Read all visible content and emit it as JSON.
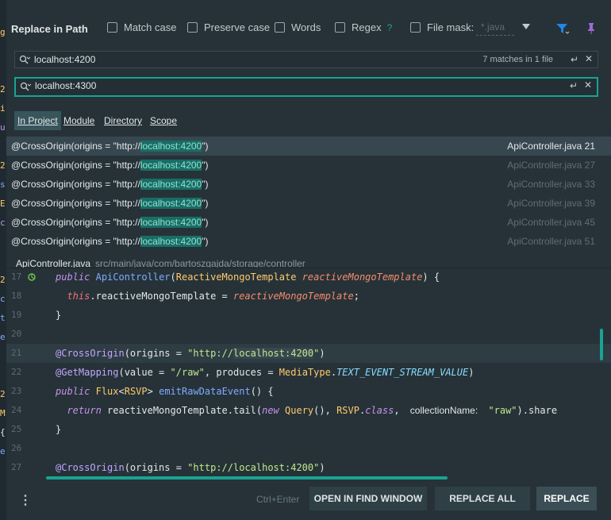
{
  "left_strip_chars": [
    "g",
    "2",
    "i",
    "u",
    "2",
    "s",
    "E",
    "c",
    "2",
    "c",
    "t",
    "e",
    "2",
    "M",
    "{",
    "e"
  ],
  "header": {
    "title": "Replace in Path",
    "options": [
      {
        "label": "Match case",
        "checked": false
      },
      {
        "label": "Preserve case",
        "checked": false
      },
      {
        "label": "Words",
        "checked": false
      },
      {
        "label": "Regex",
        "checked": false
      }
    ],
    "regex_help": "?",
    "file_mask_label": "File mask:",
    "file_mask_value": "*.java",
    "icons": [
      "filter-icon",
      "pin-icon"
    ]
  },
  "search": {
    "value": "localhost:4200",
    "matches": "7 matches in 1 file"
  },
  "replace": {
    "value": "localhost:4300"
  },
  "scopes": [
    "In Project",
    "Module",
    "Directory",
    "Scope"
  ],
  "results": [
    {
      "prefix": "@CrossOrigin(origins = \"http://",
      "match": "localhost:4200",
      "suffix": "\")",
      "file": "ApiController.java 21"
    },
    {
      "prefix": "@CrossOrigin(origins = \"http://",
      "match": "localhost:4200",
      "suffix": "\")",
      "file": "ApiController.java 27"
    },
    {
      "prefix": "@CrossOrigin(origins = \"http://",
      "match": "localhost:4200",
      "suffix": "\")",
      "file": "ApiController.java 33"
    },
    {
      "prefix": "@CrossOrigin(origins = \"http://",
      "match": "localhost:4200",
      "suffix": "\")",
      "file": "ApiController.java 39"
    },
    {
      "prefix": "@CrossOrigin(origins = \"http://",
      "match": "localhost:4200",
      "suffix": "\")",
      "file": "ApiController.java 45"
    },
    {
      "prefix": "@CrossOrigin(origins = \"http://",
      "match": "localhost:4200",
      "suffix": "\")",
      "file": "ApiController.java 51"
    }
  ],
  "preview": {
    "file_name": "ApiController.java",
    "file_path": "src/main/java/com/bartoszgajda/storage/controller",
    "line_numbers": [
      "17",
      "18",
      "19",
      "20",
      "21",
      "22",
      "23",
      "24",
      "25",
      "26",
      "27"
    ],
    "line17": {
      "kw": "public",
      "ty": "ApiController",
      "p1": "(",
      "ty2": "ReactiveMongoTemplate",
      "sp": " ",
      "it": "reactiveMongoTemplate",
      "p2": ") {"
    },
    "line18": {
      "kw": "this",
      "p1": ".reactiveMongoTemplate = ",
      "it": "reactiveMongoTemplate",
      "p2": ";"
    },
    "line19": "}",
    "line21": {
      "an": "@CrossOrigin",
      "p1": "(origins = ",
      "st": "\"http://",
      "hl": "localhost:4200",
      "st2": "\"",
      "p2": ")"
    },
    "line22": {
      "an": "@GetMapping",
      "p1": "(value = ",
      "st": "\"/raw\"",
      "p2": ", produces = ",
      "ty": "MediaType",
      "p3": ".",
      "cc": "TEXT_EVENT_STREAM_VALUE",
      "p4": ")"
    },
    "line23": {
      "kw": "public",
      "ty": "Flux",
      "p1": "<",
      "ty2": "RSVP",
      "p2": "> ",
      "fn": "emitRawDataEvent",
      "p3": "() {"
    },
    "line24": {
      "kw": "return",
      "p1": " reactiveMongoTemplate.tail(",
      "kw2": "new",
      "ty": "Query",
      "p2": "(), ",
      "ty2": "RSVP",
      "p3": ".",
      "kw3": "class",
      "p4": ",",
      "hint": "collectionName:",
      "st": "\"raw\"",
      "p5": ").share"
    },
    "line25": "}",
    "line27": {
      "an": "@CrossOrigin",
      "p1": "(origins = ",
      "st": "\"http://localhost:4200\"",
      "p2": ")"
    }
  },
  "footer": {
    "shortcut": "Ctrl+Enter",
    "open_in_find_window": "OPEN IN FIND WINDOW",
    "replace_all": "REPLACE ALL",
    "replace": "REPLACE"
  },
  "colors": {
    "accent": "#1aa391",
    "background": "#263238",
    "match_highlight": "#1a6d64"
  }
}
